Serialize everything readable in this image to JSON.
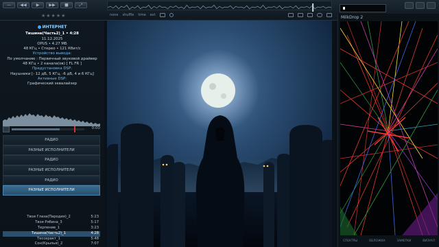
{
  "top": {
    "control_buttons": [
      "—",
      "◀◀",
      "▶",
      "▶▶",
      "■",
      "⤢"
    ],
    "rating": "★★★★★",
    "toolbar": {
      "items": [
        "none",
        "shuffle",
        "time",
        "ext"
      ]
    }
  },
  "info": {
    "source": "ИНТЕРНЕТ",
    "track_line": "Тишина(Часть2)_1 • 4:28",
    "date": "11.12.2025",
    "format_line": "OPUS • 4.27 МБ",
    "audio_line": "48 КГц • Стерео • 121 Кбит/с",
    "output_label": "Устройство вывода:",
    "output_device": "По умолчанию : Первичный звуковой драйвер",
    "output_format": "48 КГц • 2 канала(ов) [ FL FR ]",
    "dsp_preset_label": "Предустановка DSP:",
    "dsp_preset": "Наушники [- 12 дБ, 5 КГц, -6 дБ, 4 и 6 КГц]",
    "active_dsp_label": "Активные DSP:",
    "active_dsp": "Графический эквалайзер"
  },
  "seek": {
    "time": "0:00",
    "progress": 0.66,
    "marker": 0.86
  },
  "folders": [
    {
      "label": "РАДИО",
      "active": false
    },
    {
      "label": "РАЗНЫЕ ИСПОЛНИТЕЛИ",
      "active": false
    },
    {
      "label": "РАДИО",
      "active": false
    },
    {
      "label": "РАЗНЫЕ ИСПОЛНИТЕЛИ",
      "active": false
    },
    {
      "label": "РАДИО",
      "active": false
    },
    {
      "label": "РАЗНЫЕ ИСПОЛНИТЕЛИ",
      "active": true
    }
  ],
  "tracks": [
    {
      "name": "Твои Глаза(Пародия)_2",
      "length": "5:23",
      "playing": false
    },
    {
      "name": "Твоя Рябина_3",
      "length": "5:17",
      "playing": false
    },
    {
      "name": "Терпение_1",
      "length": "3:23",
      "playing": false
    },
    {
      "name": "Тишина(Часть2)_1",
      "length": "4:28",
      "playing": true
    },
    {
      "name": "Тессеракт_1",
      "length": "5:48",
      "playing": false
    },
    {
      "name": "Сон(Крылья)_2",
      "length": "7:07",
      "playing": false
    }
  ],
  "visualizer": {
    "title": "MilkDrop 2",
    "tabs": [
      "СПЕКТРЫ",
      "ОБЛОЖКА",
      "ЗАМЕТКИ",
      "ВИЗУАЛ"
    ]
  },
  "colors": {
    "accent": "#3a6c91",
    "active_row": "#2b4f6c",
    "seek_marker": "#d8342f"
  }
}
